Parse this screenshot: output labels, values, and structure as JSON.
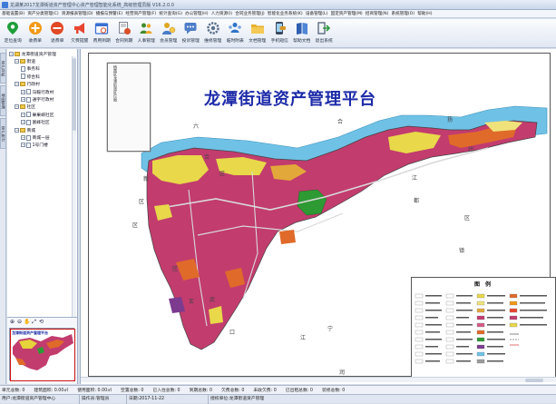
{
  "window": {
    "title": "龙湖某2017龙潭街道资产管理中心资产管理智能化系统_高级管理员版 V16.2.0.0"
  },
  "menu": [
    "基础设置(B)",
    "资产分类管理(C)",
    "资源报表管理(D)",
    "播报与预警(E)",
    "经营资产管理(F)",
    "统计查询(G)",
    "办公管理(H)",
    "人力资源(I)",
    "合同业务管理(J)",
    "智能化业务系统(K)",
    "设备管理(L)",
    "固定资产管理(M)",
    "招商管理(N)",
    "系统管理(O)",
    "帮助(H)"
  ],
  "toolbar": [
    {
      "label": "定位查询",
      "icon": "location-pin-icon",
      "color": "#1f9e3a"
    },
    {
      "label": "收费单",
      "icon": "add-circle-icon",
      "color": "#f29a18"
    },
    {
      "label": "退费单",
      "icon": "remove-circle-icon",
      "color": "#e24a26"
    },
    {
      "label": "欠费提醒",
      "icon": "megaphone-icon",
      "color": "#e8452f"
    },
    {
      "label": "费用到期",
      "icon": "calendar-clock-icon",
      "color": "#3a6fd1"
    },
    {
      "label": "合同到期",
      "icon": "contract-clock-icon",
      "color": "#d84f2a"
    },
    {
      "label": "人事管理",
      "icon": "people-icon",
      "color": "#3f8c2e"
    },
    {
      "label": "会员管理",
      "icon": "member-card-icon",
      "color": "#e0a623"
    },
    {
      "label": "投诉管理",
      "icon": "complaint-icon",
      "color": "#4e7dc9"
    },
    {
      "label": "维修管理",
      "icon": "repair-gear-icon",
      "color": "#5b6e8c"
    },
    {
      "label": "临时附表",
      "icon": "people-group-icon",
      "color": "#2e74c8"
    },
    {
      "label": "文档管理",
      "icon": "folder-icon",
      "color": "#e6b02c"
    },
    {
      "label": "手机短信",
      "icon": "mobile-message-icon",
      "color": "#d9982a"
    },
    {
      "label": "帮助文档",
      "icon": "book-icon",
      "color": "#2f5fb1"
    },
    {
      "label": "退出系统",
      "icon": "exit-icon",
      "color": "#5d6b80"
    }
  ],
  "left_tabs": [
    "资产导航",
    "地图管理",
    "资产统计"
  ],
  "tree": {
    "root": "龙潭街道资产管理",
    "nodes": [
      {
        "label": "街道",
        "level": 1,
        "expander": "⊟",
        "kind": "folder"
      },
      {
        "label": "事务科",
        "level": 2,
        "expander": "",
        "kind": "doc"
      },
      {
        "label": "综合科",
        "level": 2,
        "expander": "",
        "kind": "doc"
      },
      {
        "label": "行政村",
        "level": 1,
        "expander": "⊟",
        "kind": "folder"
      },
      {
        "label": "马鞍行政村",
        "level": 2,
        "expander": "⊟",
        "kind": "doc"
      },
      {
        "label": "通宇行政村",
        "level": 2,
        "expander": "⊟",
        "kind": "doc"
      },
      {
        "label": "社区",
        "level": 1,
        "expander": "⊟",
        "kind": "folder"
      },
      {
        "label": "果果峡社区",
        "level": 2,
        "expander": "⊟",
        "kind": "doc"
      },
      {
        "label": "富峰社区",
        "level": 2,
        "expander": "⊟",
        "kind": "doc"
      },
      {
        "label": "商城",
        "level": 1,
        "expander": "⊟",
        "kind": "folder"
      },
      {
        "label": "商城一层",
        "level": 2,
        "expander": "⊟",
        "kind": "doc"
      },
      {
        "label": "1号门楼",
        "level": 2,
        "expander": "⊟",
        "kind": "doc"
      }
    ]
  },
  "nav_tools": [
    "⊕",
    "⊖",
    "✋",
    "⤢",
    "⟲"
  ],
  "map": {
    "title": "龙潭街道资产管理平台",
    "inset_caption": "栖霞区龙潭街道区位图",
    "legend_title": "图 例",
    "places": [
      "六",
      "合",
      "区",
      "合",
      "扬",
      "州",
      "江",
      "都",
      "区",
      "镇",
      "江",
      "新",
      "区",
      "区",
      "玄",
      "武",
      "宁",
      "江",
      "润",
      "口",
      "区",
      "二"
    ]
  },
  "stats": [
    "单元总数: 0",
    "建筑面积: 0.00㎡",
    "使用面积: 0.00㎡",
    "空置总数: 0",
    "已入住总数: 0",
    "到期总数: 0",
    "欠费总数: 0",
    "未收欠费: 0",
    "已出租总数: 0",
    "装修总数: 0"
  ],
  "status": {
    "user": "用户:龙潭街道资产管理中心",
    "operator": "操作员:管理员",
    "date": "日期:2017-11-22",
    "org": "授权单位:龙潭街道资产管理"
  }
}
